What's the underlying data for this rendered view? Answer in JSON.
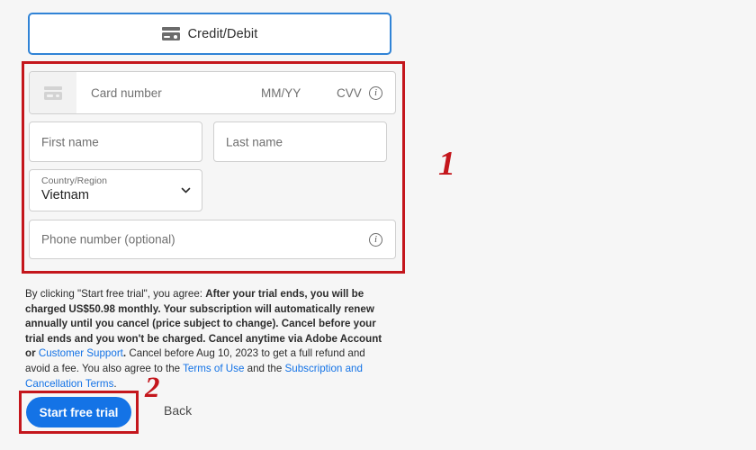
{
  "page": {
    "background_color": "#f6f6f6",
    "accent_blue": "#1473e6",
    "annotation_red": "#c4161c"
  },
  "payment_tab": {
    "label": "Credit/Debit",
    "icon": "credit-card-icon",
    "selected": true,
    "border_color": "#3083d6"
  },
  "form": {
    "card": {
      "icon": "credit-card-icon",
      "number_placeholder": "Card number",
      "expiry_placeholder": "MM/YY",
      "cvv_placeholder": "CVV",
      "info_icon": "info-icon"
    },
    "first_name": {
      "placeholder": "First name",
      "value": ""
    },
    "last_name": {
      "placeholder": "Last name",
      "value": ""
    },
    "country": {
      "label": "Country/Region",
      "value": "Vietnam",
      "chevron_icon": "chevron-down-icon"
    },
    "phone": {
      "placeholder": "Phone number (optional)",
      "value": "",
      "info_icon": "info-icon"
    }
  },
  "terms": {
    "part1": "By clicking \"Start free trial\", you agree: ",
    "bold1": "After your trial ends, you will be charged US$50.98 monthly. Your subscription will automatically renew annually until you cancel (price subject to change). Cancel before your trial ends and you won't be charged. Cancel anytime via Adobe Account or ",
    "link_customer_support": "Customer Support",
    "bold2": ". ",
    "part2": "Cancel before Aug 10, 2023 to get a full refund and avoid a fee. You also agree to the ",
    "link_terms_of_use": "Terms of Use",
    "part3": " and the ",
    "link_subscription_terms": "Subscription and Cancellation Terms",
    "part4": "."
  },
  "footer": {
    "start_trial_label": "Start free trial",
    "back_label": "Back"
  },
  "annotations": {
    "marker_one": "1",
    "marker_two": "2"
  }
}
